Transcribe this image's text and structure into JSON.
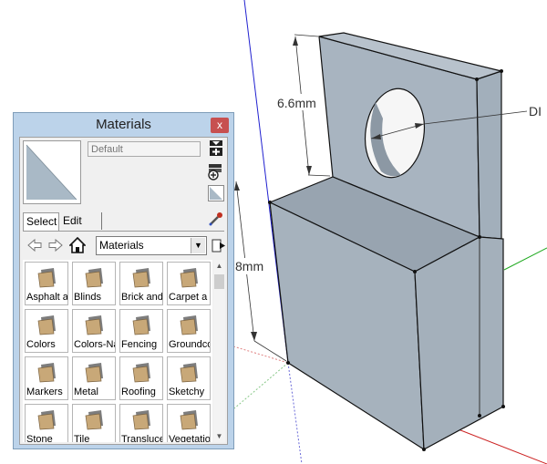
{
  "viewport": {
    "dimensions": [
      "6.6mm",
      "8mm",
      "DI"
    ]
  },
  "materials_window": {
    "title": "Materials",
    "close_label": "x",
    "material_name_placeholder": "Default",
    "tabs": [
      {
        "label": "Select",
        "active": true
      },
      {
        "label": "Edit",
        "active": false
      }
    ],
    "library_select": "Materials",
    "items": [
      "Asphalt a",
      "Blinds",
      "Brick and",
      "Carpet a",
      "Colors",
      "Colors-Na",
      "Fencing",
      "Groundco",
      "Markers",
      "Metal",
      "Roofing",
      "Sketchy",
      "Stone",
      "Tile",
      "Transluce",
      "Vegetatio"
    ],
    "icons": {
      "preview": "material-preview-icon",
      "display_secondary": "display-secondary-selection-pane-icon",
      "create": "create-material-icon",
      "paint": "default-material-icon",
      "sample": "sample-paint-eyedropper-icon",
      "back": "back-arrow-icon",
      "forward": "forward-arrow-icon",
      "home": "home-icon",
      "details": "details-arrow-icon",
      "folder": "folder-icon"
    },
    "colors": {
      "title_bar": "#bcd3ea",
      "close_button": "#c75050",
      "preview_fill": "#a9b9c6"
    }
  }
}
